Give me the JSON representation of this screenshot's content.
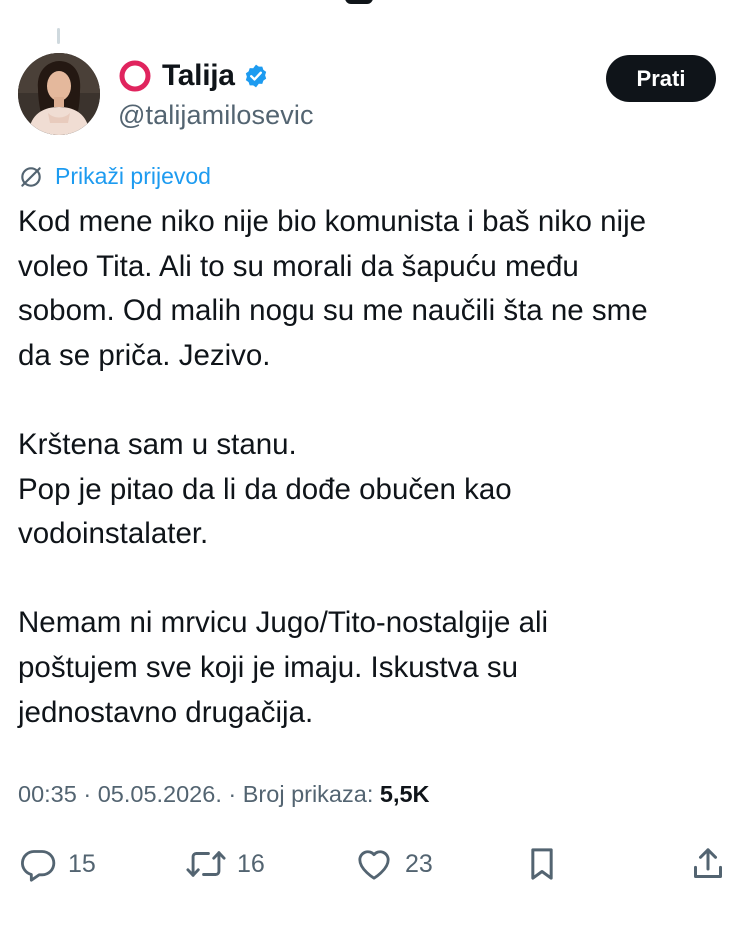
{
  "tweet": {
    "author": {
      "name_emoji": "⭕",
      "display_name": "Talija",
      "verified": true,
      "handle": "@talijamilosevic"
    },
    "follow_label": "Prati",
    "translate_label": "Prikaži prijevod",
    "text_lines": [
      "Kod mene niko nije bio komunista i baš niko nije",
      "voleo Tita. Ali to su morali da šapuću među",
      "sobom. Od malih nogu su me naučili šta ne sme",
      "da se priča. Jezivo.",
      "",
      "Krštena sam u stanu.",
      "Pop je pitao da li da dođe obučen kao",
      "vodoinstalater.",
      "",
      "Nemam ni mrvicu Jugo/Tito-nostalgije ali",
      "poštujem sve koji je imaju. Iskustva su",
      "jednostavno drugačija."
    ],
    "meta": {
      "time": "00:35",
      "separator": " · ",
      "date": "05.05.2026.",
      "views_label": "Broj prikaza:",
      "views_count": "5,5K"
    },
    "actions": {
      "replies": "15",
      "reposts": "16",
      "likes": "23"
    }
  },
  "icons": {
    "verified": "verified-badge-icon",
    "translate": "translate-icon",
    "reply": "reply-icon",
    "repost": "repost-icon",
    "like": "heart-icon",
    "bookmark": "bookmark-icon",
    "share": "share-icon"
  },
  "colors": {
    "text": "#0f1419",
    "secondary": "#536471",
    "accent": "#1d9bf0",
    "ring": "#e0245e",
    "button_bg": "#0f1419"
  }
}
